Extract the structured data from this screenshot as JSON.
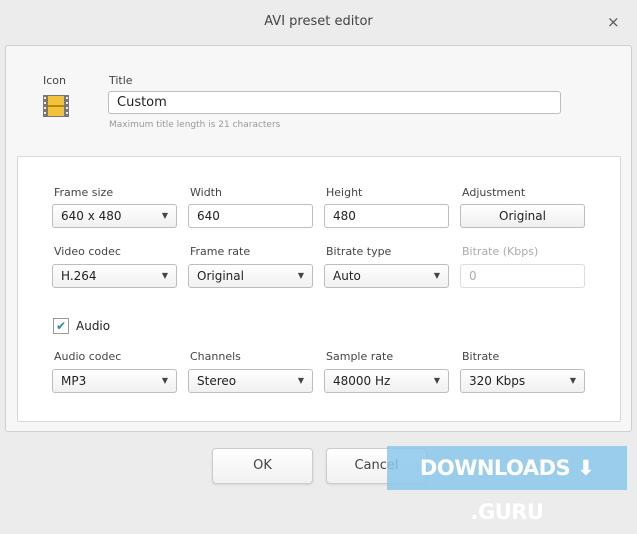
{
  "window": {
    "title": "AVI preset editor",
    "close": "×"
  },
  "header": {
    "icon_label": "Icon",
    "title_label": "Title",
    "title_value": "Custom",
    "hint": "Maximum title length is 21 characters"
  },
  "video": {
    "frame_size": {
      "label": "Frame size",
      "value": "640 x 480"
    },
    "width": {
      "label": "Width",
      "value": "640"
    },
    "height": {
      "label": "Height",
      "value": "480"
    },
    "adjustment": {
      "label": "Adjustment",
      "value": "Original"
    },
    "codec": {
      "label": "Video codec",
      "value": "H.264"
    },
    "frame_rate": {
      "label": "Frame rate",
      "value": "Original"
    },
    "bitrate_type": {
      "label": "Bitrate type",
      "value": "Auto"
    },
    "bitrate": {
      "label": "Bitrate (Kbps)",
      "value": "0"
    }
  },
  "audio": {
    "checkbox_label": "Audio",
    "checked": true,
    "codec": {
      "label": "Audio codec",
      "value": "MP3"
    },
    "channels": {
      "label": "Channels",
      "value": "Stereo"
    },
    "sample_rate": {
      "label": "Sample rate",
      "value": "48000 Hz"
    },
    "bitrate": {
      "label": "Bitrate",
      "value": "320 Kbps"
    }
  },
  "footer": {
    "ok": "OK",
    "cancel": "Cancel"
  },
  "watermark": "DOWNLOADS ⬇ .GURU"
}
